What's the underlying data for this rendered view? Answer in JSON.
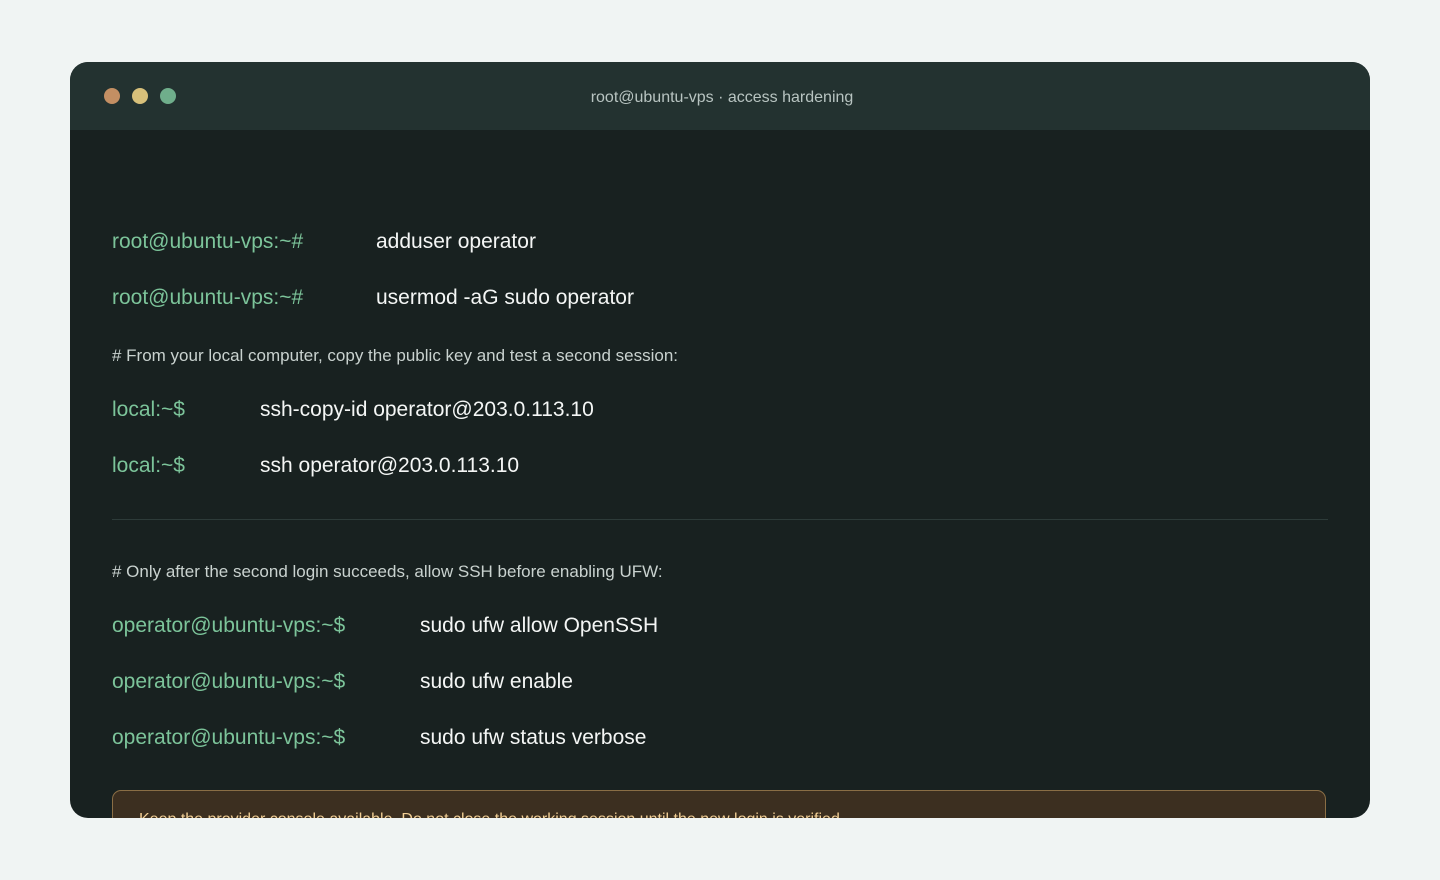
{
  "window": {
    "title": "root@ubuntu-vps · access hardening",
    "traffic_lights": {
      "close_color": "#c38f63",
      "minimize_color": "#d7c07a",
      "maximize_color": "#6fae8b"
    }
  },
  "colors": {
    "prompt": "#7cc49a",
    "command": "#f4f6f5",
    "comment": "#c9d2cf",
    "warning_text": "#f2cf95",
    "warning_border": "#8a6e45",
    "warning_background": "#3c2f20"
  },
  "terminal": {
    "lines": [
      {
        "prompt": "root@ubuntu-vps:~#",
        "command": "adduser operator"
      },
      {
        "prompt": "root@ubuntu-vps:~#",
        "command": "usermod -aG sudo operator"
      },
      {
        "comment": "# From your local computer, copy the public key and test a second session:"
      },
      {
        "prompt": "local:~$",
        "command": "ssh-copy-id operator@203.0.113.10"
      },
      {
        "prompt": "local:~$",
        "command": "ssh operator@203.0.113.10"
      },
      {
        "comment": "# Only after the second login succeeds, allow SSH before enabling UFW:"
      },
      {
        "prompt": "operator@ubuntu-vps:~$",
        "command": "sudo ufw allow OpenSSH"
      },
      {
        "prompt": "operator@ubuntu-vps:~$",
        "command": "sudo ufw enable"
      },
      {
        "prompt": "operator@ubuntu-vps:~$",
        "command": "sudo ufw status verbose"
      }
    ]
  },
  "warning": {
    "text": "Keep the provider console available. Do not close the working session until the new login is verified."
  }
}
